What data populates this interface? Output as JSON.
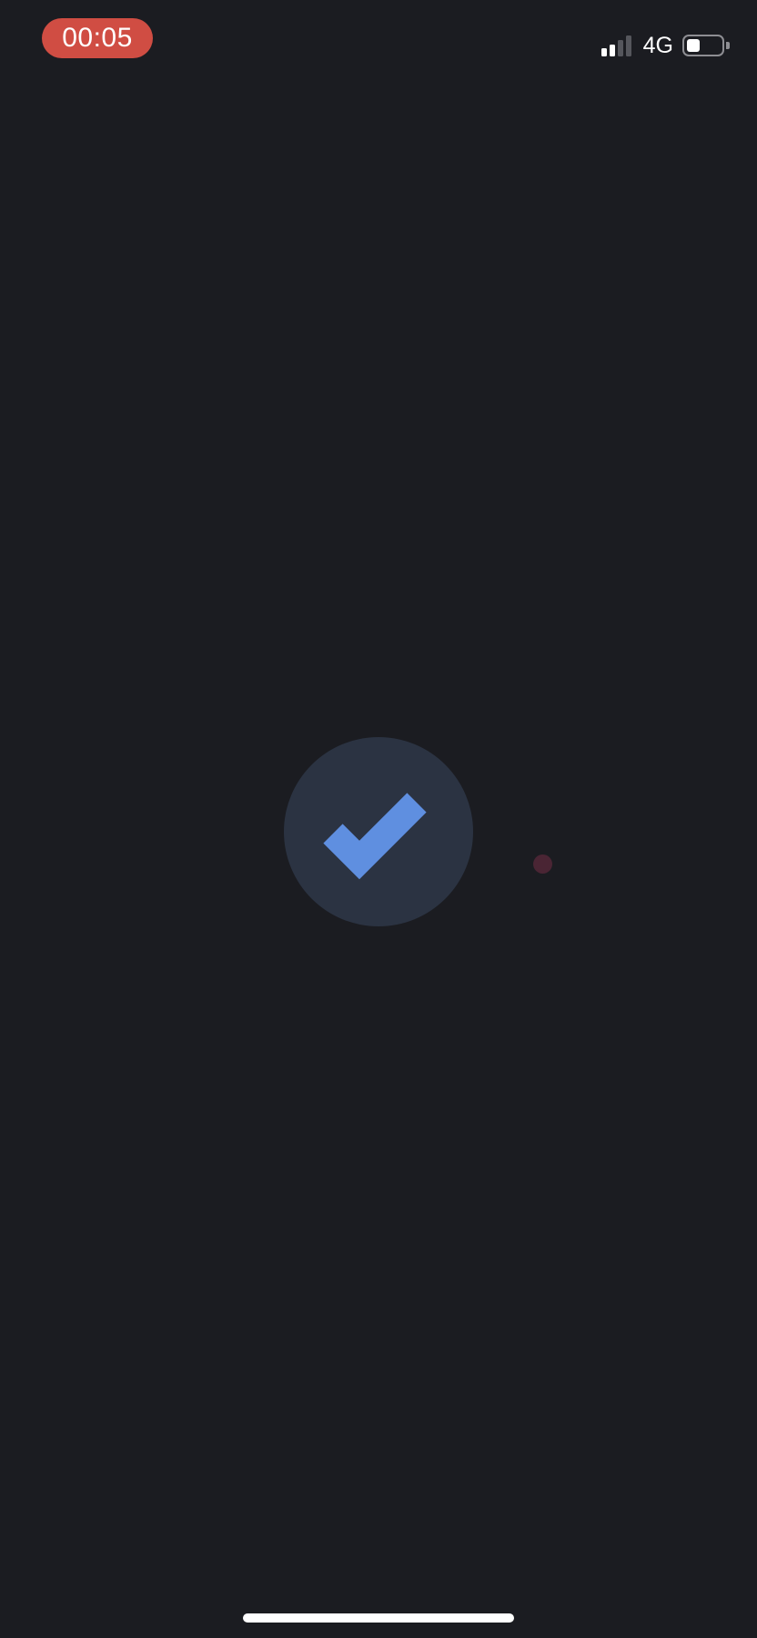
{
  "status_bar": {
    "recording_time": "00:05",
    "network": "4G",
    "signal_bars_active": 2,
    "signal_bars_total": 4,
    "battery_level": 0.4
  },
  "main": {
    "success_icon": "checkmark-icon"
  },
  "colors": {
    "background": "#1b1c21",
    "recording_pill": "#d04d43",
    "check_badge": "#2b3342",
    "check_mark": "#5f8fe0",
    "touch_dot": "#4a2534",
    "signal_inactive": "#55565c"
  }
}
